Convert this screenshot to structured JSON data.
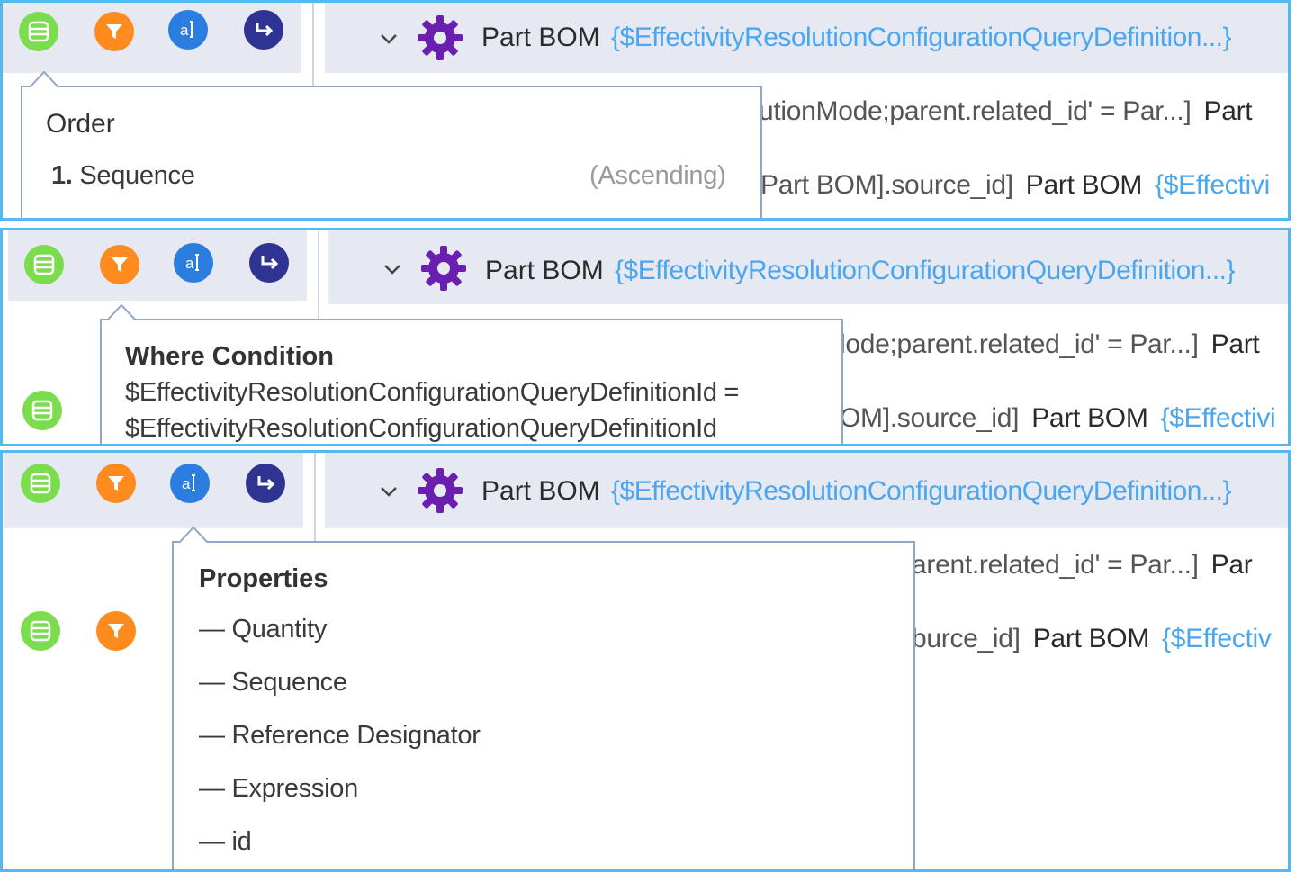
{
  "header": {
    "name": "Part BOM",
    "param": "{$EffectivityResolutionConfigurationQueryDefinition...}"
  },
  "rows": {
    "p1_row1": "utionMode;parent.related_id' = Par...]",
    "p1_row2": "Part BOM].source_id]",
    "p2_row1": "lode;parent.related_id' = Par...]",
    "p2_row2": "OM].source_id]",
    "p3_row1": "arent.related_id' = Par...]",
    "p3_row2": "burce_id]",
    "row1_tail": "Part",
    "row2_name": "Part BOM",
    "row2_param_p1": "{$Effectivi",
    "row2_param_p2": "{$Effectivi",
    "row2_param_p3": "{$Effectiv",
    "row1_tail_p3": "Par"
  },
  "tooltips": {
    "order": {
      "title": "Order",
      "item_number": "1.",
      "item_label": "Sequence",
      "item_direction": "(Ascending)"
    },
    "where": {
      "title": "Where Condition",
      "line1": "$EffectivityResolutionConfigurationQueryDefinitionId =",
      "line2": "$EffectivityResolutionConfigurationQueryDefinitionId"
    },
    "properties": {
      "title": "Properties",
      "items": [
        "— Quantity",
        "— Sequence",
        "— Reference Designator",
        "— Expression",
        "— id"
      ]
    }
  },
  "icons": {
    "order": "list-icon",
    "filter": "filter-icon",
    "properties": "properties-icon",
    "join": "join-icon",
    "expand": "chevron-down-icon",
    "item_type": "gear-icon"
  },
  "colors": {
    "accent_border": "#55b8f0",
    "green": "#7bdc4e",
    "orange": "#ff8b1e",
    "blue": "#2b7ee0",
    "navy": "#2f3492",
    "gear": "#6a1fb0",
    "param_text": "#4aa6ef"
  }
}
